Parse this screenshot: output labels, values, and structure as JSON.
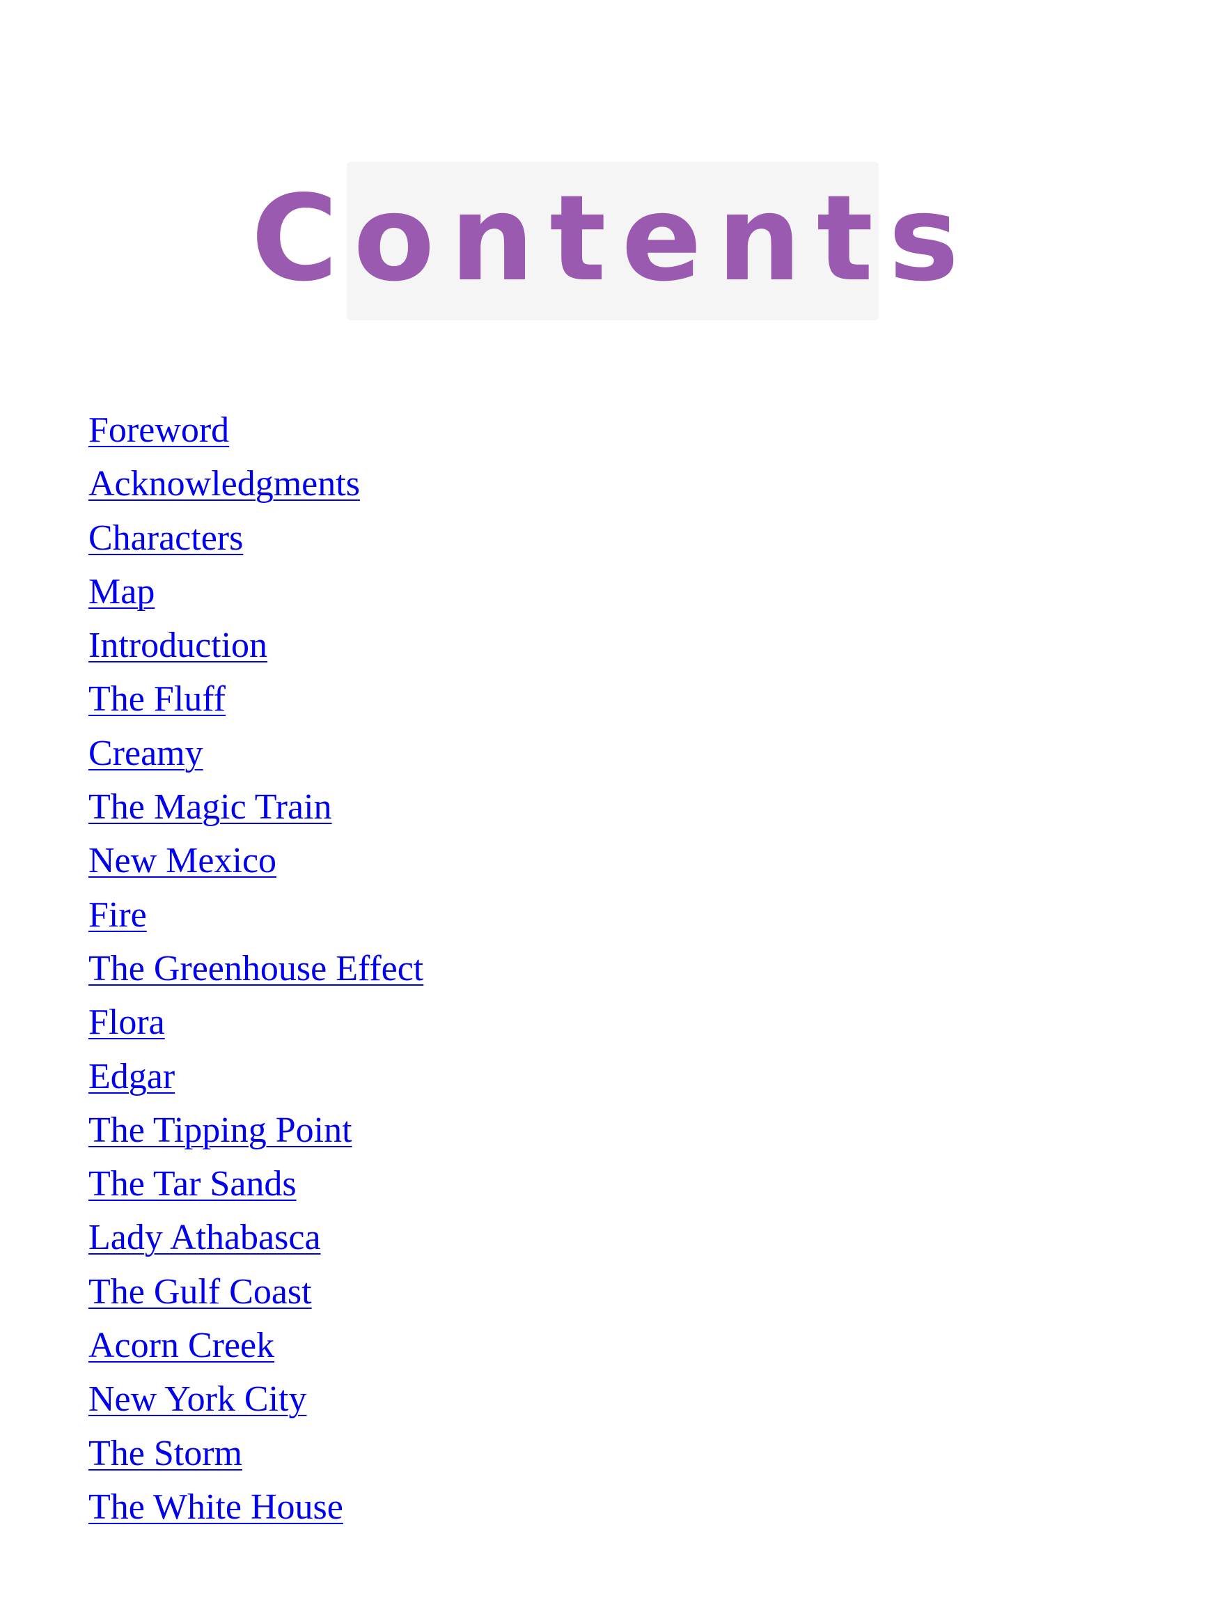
{
  "title": "Contents",
  "colors": {
    "title_purple": "#9a5ab0",
    "link_blue": "#0000ee",
    "title_background": "#f5f5f5"
  },
  "toc": [
    "Foreword",
    "Acknowledgments",
    "Characters",
    "Map",
    "Introduction",
    "The Fluff",
    "Creamy",
    "The Magic Train",
    "New Mexico",
    "Fire",
    "The Greenhouse Effect",
    "Flora",
    "Edgar",
    "The Tipping Point",
    "The Tar Sands",
    "Lady Athabasca",
    "The Gulf Coast",
    "Acorn Creek",
    "New York City",
    "The Storm",
    "The White House"
  ]
}
